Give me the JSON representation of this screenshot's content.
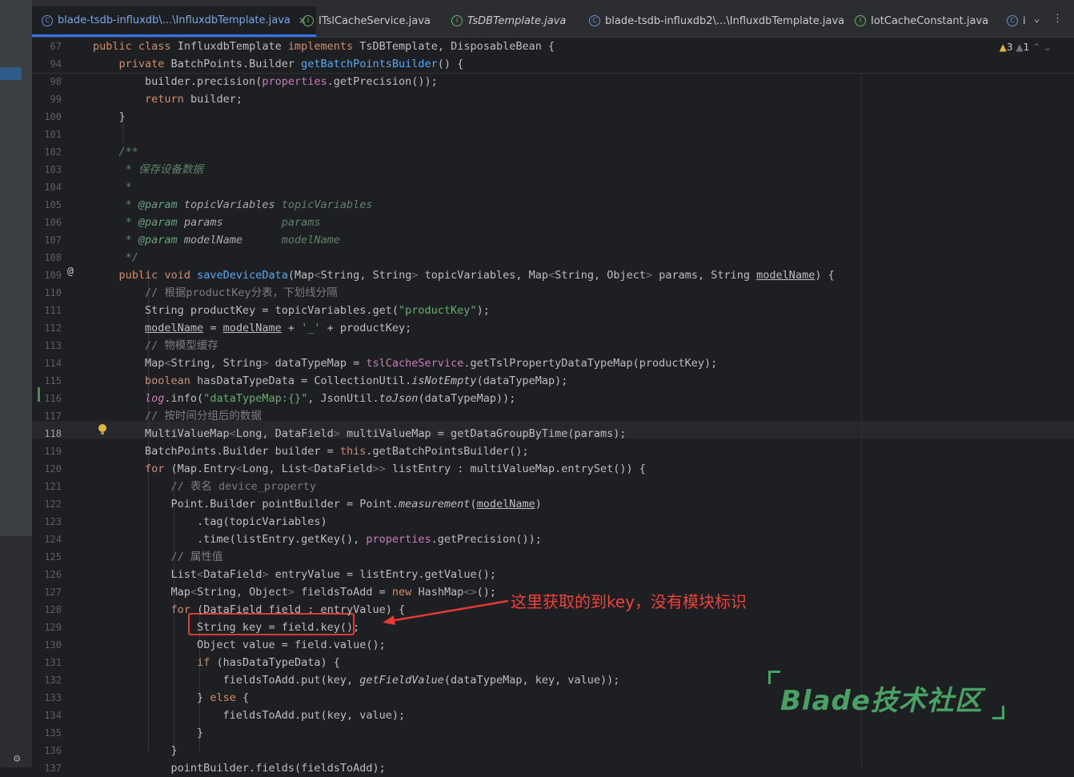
{
  "tabs": [
    {
      "label": "blade-tsdb-influxdb\\...\\InfluxdbTemplate.java",
      "icon": "class-icon",
      "active": true
    },
    {
      "label": "ITslCacheService.java",
      "icon": "interface-icon"
    },
    {
      "label": "TsDBTemplate.java",
      "icon": "interface-icon"
    },
    {
      "label": "blade-tsdb-influxdb2\\...\\InfluxdbTemplate.java",
      "icon": "class-icon"
    },
    {
      "label": "IotCacheConstant.java",
      "icon": "interface-icon"
    },
    {
      "label": "i",
      "icon": "class-icon"
    }
  ],
  "warnings": {
    "warn_count": "3",
    "weak_count": "1"
  },
  "annotation": {
    "text": "这里获取的到key，没有模块标识"
  },
  "watermark": {
    "text": "Blade技术社区"
  },
  "code": [
    {
      "n": "67",
      "t": "public class InfluxdbTemplate implements TsDBTemplate, DisposableBean {"
    },
    {
      "n": "94",
      "t": "    private BatchPoints.Builder getBatchPointsBuilder() {"
    },
    {
      "n": "98",
      "t": "        builder.precision(properties.getPrecision());"
    },
    {
      "n": "99",
      "t": "        return builder;"
    },
    {
      "n": "100",
      "t": "    }"
    },
    {
      "n": "101",
      "t": ""
    },
    {
      "n": "102",
      "t": "    /**"
    },
    {
      "n": "103",
      "t": "     * 保存设备数据"
    },
    {
      "n": "104",
      "t": "     *"
    },
    {
      "n": "105",
      "t": "     * @param topicVariables topicVariables"
    },
    {
      "n": "106",
      "t": "     * @param params         params"
    },
    {
      "n": "107",
      "t": "     * @param modelName      modelName"
    },
    {
      "n": "108",
      "t": "     */"
    },
    {
      "n": "109",
      "t": "    public void saveDeviceData(Map<String, String> topicVariables, Map<String, Object> params, String modelName) {"
    },
    {
      "n": "110",
      "t": "        // 根据productKey分表，下划线分隔"
    },
    {
      "n": "111",
      "t": "        String productKey = topicVariables.get(\"productKey\");"
    },
    {
      "n": "112",
      "t": "        modelName = modelName + '_' + productKey;"
    },
    {
      "n": "113",
      "t": "        // 物模型缓存"
    },
    {
      "n": "114",
      "t": "        Map<String, String> dataTypeMap = tslCacheService.getTslPropertyDataTypeMap(productKey);"
    },
    {
      "n": "115",
      "t": "        boolean hasDataTypeData = CollectionUtil.isNotEmpty(dataTypeMap);"
    },
    {
      "n": "116",
      "t": "        log.info(\"dataTypeMap:{}\", JsonUtil.toJson(dataTypeMap));"
    },
    {
      "n": "117",
      "t": "        // 按时间分组后的数据"
    },
    {
      "n": "118",
      "t": "        MultiValueMap<Long, DataField> multiValueMap = getDataGroupByTime(params);"
    },
    {
      "n": "119",
      "t": "        BatchPoints.Builder builder = this.getBatchPointsBuilder();"
    },
    {
      "n": "120",
      "t": "        for (Map.Entry<Long, List<DataField>> listEntry : multiValueMap.entrySet()) {"
    },
    {
      "n": "121",
      "t": "            // 表名 device_property"
    },
    {
      "n": "122",
      "t": "            Point.Builder pointBuilder = Point.measurement(modelName)"
    },
    {
      "n": "123",
      "t": "                .tag(topicVariables)"
    },
    {
      "n": "124",
      "t": "                .time(listEntry.getKey(), properties.getPrecision());"
    },
    {
      "n": "125",
      "t": "            // 属性值"
    },
    {
      "n": "126",
      "t": "            List<DataField> entryValue = listEntry.getValue();"
    },
    {
      "n": "127",
      "t": "            Map<String, Object> fieldsToAdd = new HashMap<>();"
    },
    {
      "n": "128",
      "t": "            for (DataField field : entryValue) {"
    },
    {
      "n": "129",
      "t": "                String key = field.key();"
    },
    {
      "n": "130",
      "t": "                Object value = field.value();"
    },
    {
      "n": "131",
      "t": "                if (hasDataTypeData) {"
    },
    {
      "n": "132",
      "t": "                    fieldsToAdd.put(key, getFieldValue(dataTypeMap, key, value));"
    },
    {
      "n": "133",
      "t": "                } else {"
    },
    {
      "n": "134",
      "t": "                    fieldsToAdd.put(key, value);"
    },
    {
      "n": "135",
      "t": "                }"
    },
    {
      "n": "136",
      "t": "            }"
    },
    {
      "n": "137",
      "t": "            pointBuilder.fields(fieldsToAdd);"
    }
  ],
  "colors": {
    "keyword": "#cf8e6d",
    "method": "#56a8f5",
    "string": "#6aab73",
    "comment": "#7a7e85",
    "field": "#c77dbb",
    "annotation": "#f0413a",
    "watermark": "#4aa164"
  }
}
